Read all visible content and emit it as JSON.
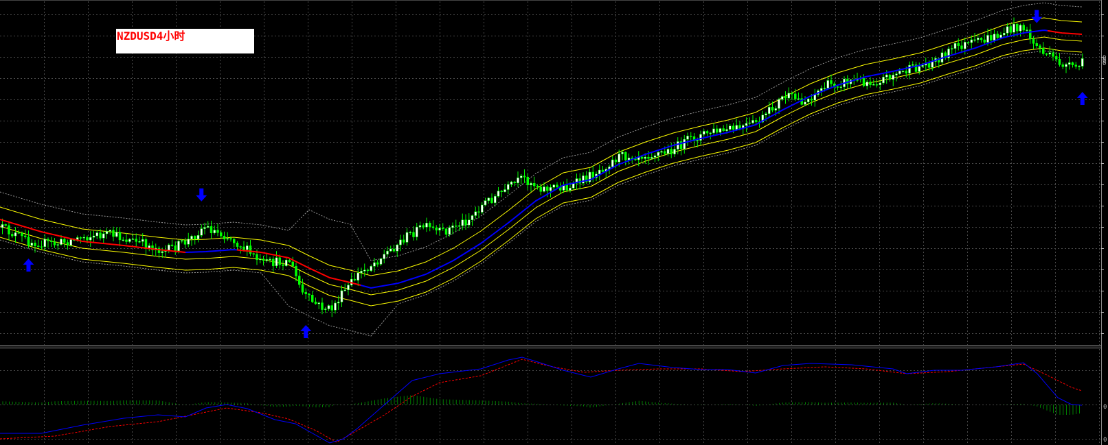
{
  "chart_label": "NZDUSD4小时",
  "colors": {
    "background": "#000000",
    "grid": "#4a4a4a",
    "bull_candle": "#ffffff",
    "bear_candle": "#00ff00",
    "wick": "#00ff00",
    "trend_up": "#0000ff",
    "trend_down": "#ff0000",
    "envelope": "#ffff00",
    "bollinger": "#9a9a9a",
    "macd_line": "#0000ff",
    "signal_line": "#ff0000",
    "histogram": "#008000",
    "signal_arrow": "#0000ff",
    "label_text": "#ff0000",
    "label_bg": "#ffffff"
  },
  "chart_data": [
    {
      "type": "candlestick",
      "title": "NZDUSD4小时",
      "overlays": [
        "trend moving average (blue up / red down)",
        "yellow envelope bands",
        "dotted bollinger bands"
      ],
      "arrows": [
        {
          "direction": "up",
          "bar": 8
        },
        {
          "direction": "down",
          "bar": 61
        },
        {
          "direction": "up",
          "bar": 93
        },
        {
          "direction": "down",
          "bar": 317
        },
        {
          "direction": "up",
          "bar": 331
        }
      ],
      "price_axis_labels": [
        "0",
        "0",
        "0"
      ],
      "grid": true
    },
    {
      "type": "line",
      "title": "",
      "series": [
        {
          "values": "MACD-style oscillator line"
        },
        {
          "values": "signal line"
        }
      ],
      "histogram": true,
      "axis_labels": [
        "0",
        "0"
      ],
      "grid": true
    }
  ]
}
